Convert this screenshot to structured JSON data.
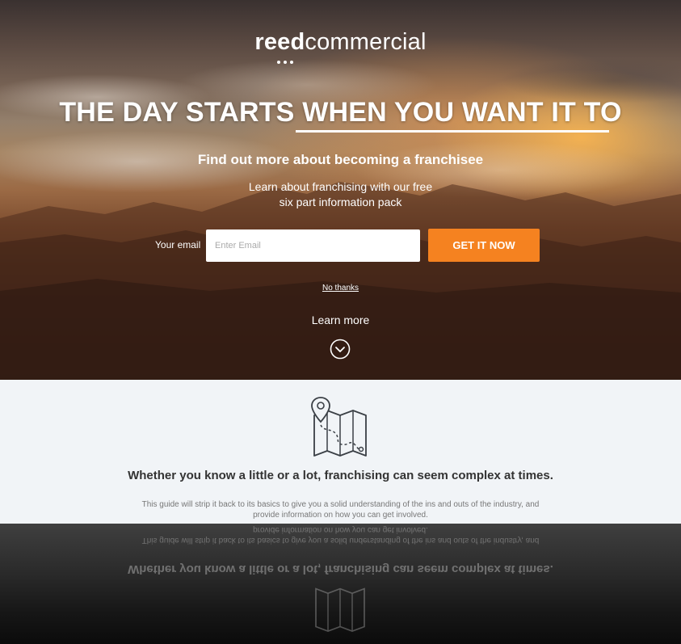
{
  "brand": {
    "logo_bold": "reed",
    "logo_light": "commercial",
    "accent_color": "#f58220"
  },
  "hero": {
    "headline": "THE DAY STARTS WHEN YOU WANT IT TO",
    "subheading": "Find out more about becoming a franchisee",
    "intro_line1": "Learn about franchising with our free",
    "intro_line2": "six part information pack",
    "form": {
      "email_label": "Your email",
      "email_placeholder": "Enter Email",
      "submit_label": "GET IT NOW"
    },
    "no_thanks_label": "No thanks",
    "learn_more_label": "Learn more",
    "down_icon": "chevron-down-circle-icon"
  },
  "info": {
    "icon": "map-pin-icon",
    "heading": "Whether you know a little or a lot, franchising can seem complex at times.",
    "body": "This guide will strip it back to its basics to give you a solid understanding of the ins and outs of the industry, and provide information on how you can get involved."
  }
}
